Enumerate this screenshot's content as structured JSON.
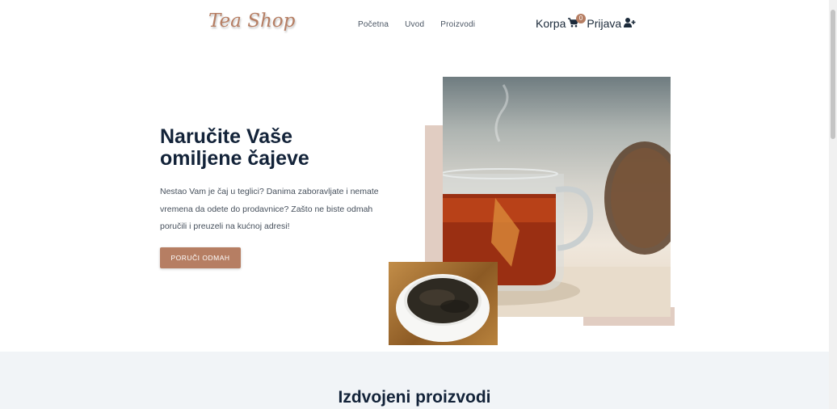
{
  "header": {
    "logo": "Tea Shop",
    "nav": [
      "Početna",
      "Uvod",
      "Proizvodi"
    ],
    "cart_label": "Korpa",
    "cart_count": "0",
    "login_label": "Prijava"
  },
  "hero": {
    "title": "Naručite Vaše omiljene čajeve",
    "text": "Nestao Vam je čaj u teglici? Danima zaboravljate i nemate vremena da odete do prodavnice? Zašto ne biste odmah poručili i preuzeli na kućnoj adresi!",
    "cta": "Poruči odmah"
  },
  "featured": {
    "title": "Izdvojeni proizvodi"
  },
  "colors": {
    "accent": "#b67e63",
    "heading": "#132339",
    "deco": "#e1cdc2",
    "section_bg": "#f1f4f7"
  }
}
